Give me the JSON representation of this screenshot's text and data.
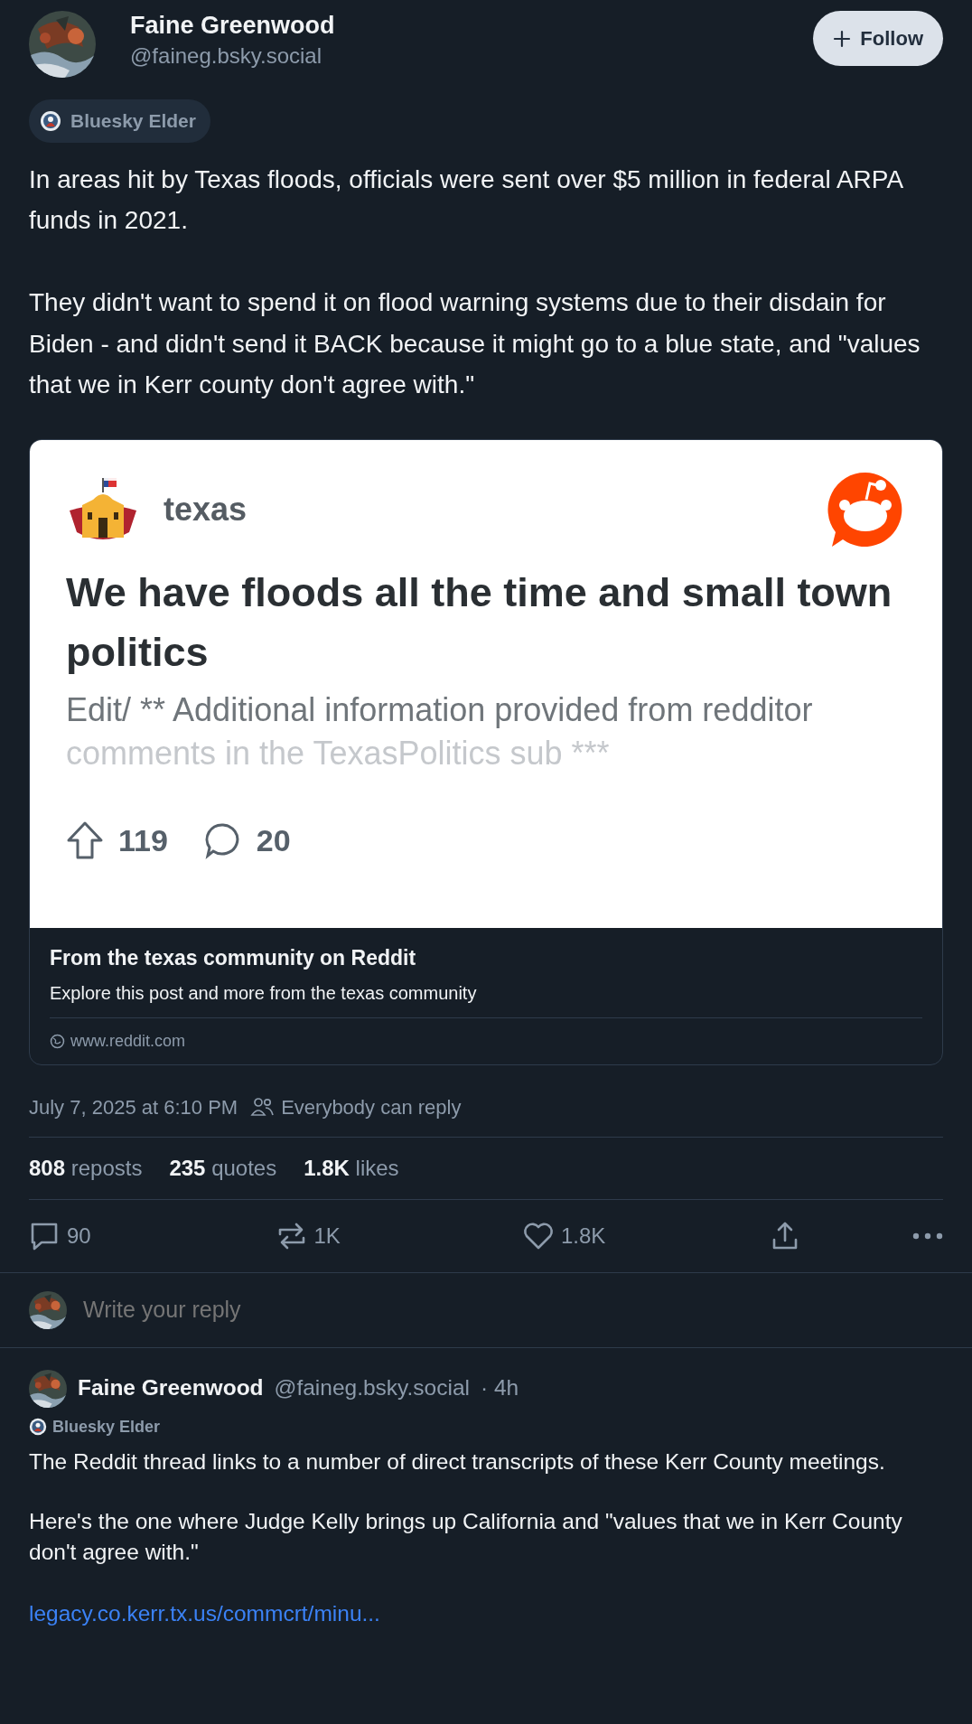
{
  "post": {
    "author": {
      "name": "Faine Greenwood",
      "handle": "@faineg.bsky.social"
    },
    "follow_button": {
      "label": "Follow"
    },
    "badge": {
      "label": "Bluesky Elder"
    },
    "paragraphs": [
      "In areas hit by Texas floods, officials were sent over $5 million in federal ARPA funds in 2021.",
      "They didn't want to spend it on flood warning systems due to their disdain for Biden - and didn't send it BACK because it might go to a blue state, and \"values that we in Kerr county don't agree with.\""
    ],
    "embed": {
      "community": "texas",
      "title": "We have floods all the time and small town politics",
      "excerpt": [
        "Edit/ ** Additional information provided from redditor",
        "comments in the TexasPolitics sub ***"
      ],
      "upvotes": "119",
      "comments": "20",
      "footer_title": "From the texas community on Reddit",
      "footer_description": "Explore this post and more from the texas community",
      "domain": "www.reddit.com"
    },
    "timestamp": "July 7, 2025 at 6:10 PM",
    "reply_setting": "Everybody can reply",
    "stats": [
      {
        "count": "808",
        "label": "reposts"
      },
      {
        "count": "235",
        "label": "quotes"
      },
      {
        "count": "1.8K",
        "label": "likes"
      }
    ],
    "actions": [
      {
        "kind": "reply",
        "count": "90"
      },
      {
        "kind": "repost",
        "count": "1K"
      },
      {
        "kind": "like",
        "count": "1.8K"
      },
      {
        "kind": "share"
      },
      {
        "kind": "more"
      }
    ]
  },
  "reply_composer": {
    "placeholder": "Write your reply"
  },
  "reply": {
    "name": "Faine Greenwood",
    "handle": "@faineg.bsky.social",
    "time": "· 4h",
    "badge": "Bluesky Elder",
    "paragraphs": [
      "The Reddit thread links to a number of direct transcripts of these Kerr County meetings.",
      "Here's the one where Judge Kelly brings up California and \"values that we in Kerr County don't agree with.\""
    ],
    "link": "legacy.co.kerr.tx.us/commcrt/minu..."
  }
}
